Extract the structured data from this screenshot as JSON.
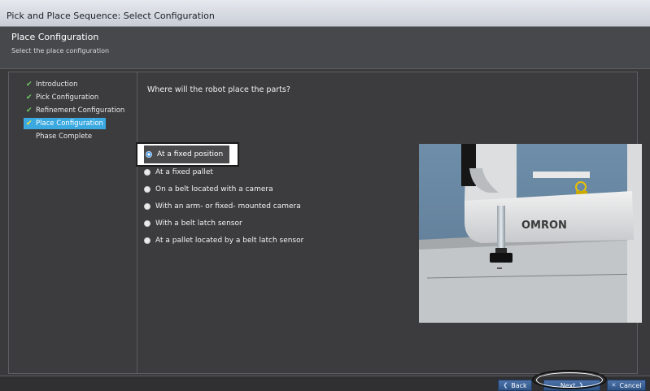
{
  "window": {
    "title": "Pick and Place Sequence: Select Configuration"
  },
  "header": {
    "title": "Place Configuration",
    "subtitle": "Select the place configuration"
  },
  "nav": {
    "items": [
      {
        "label": "Introduction",
        "icon": "check-icon",
        "state": "done"
      },
      {
        "label": "Pick Configuration",
        "icon": "check-icon",
        "state": "done"
      },
      {
        "label": "Refinement Configuration",
        "icon": "check-icon",
        "state": "done"
      },
      {
        "label": "Place Configuration",
        "icon": "check-icon",
        "state": "active"
      },
      {
        "label": "Phase Complete",
        "icon": "",
        "state": "pending"
      }
    ]
  },
  "main": {
    "question": "Where will the robot place the parts?",
    "options": [
      {
        "label": "At a fixed position",
        "selected": true
      },
      {
        "label": "At a fixed pallet",
        "selected": false
      },
      {
        "label": "On a belt located with a camera",
        "selected": false
      },
      {
        "label": "With an arm- or fixed- mounted camera",
        "selected": false
      },
      {
        "label": "With a belt latch sensor",
        "selected": false
      },
      {
        "label": "At a pallet located by a belt latch sensor",
        "selected": false
      }
    ],
    "image": {
      "brand_text": "OMRON"
    }
  },
  "footer": {
    "back_label": "Back",
    "next_label": "Next",
    "cancel_label": "Cancel"
  },
  "colors": {
    "active_nav": "#39a9e0",
    "check": "#6fd061",
    "button": "#3d639a"
  }
}
